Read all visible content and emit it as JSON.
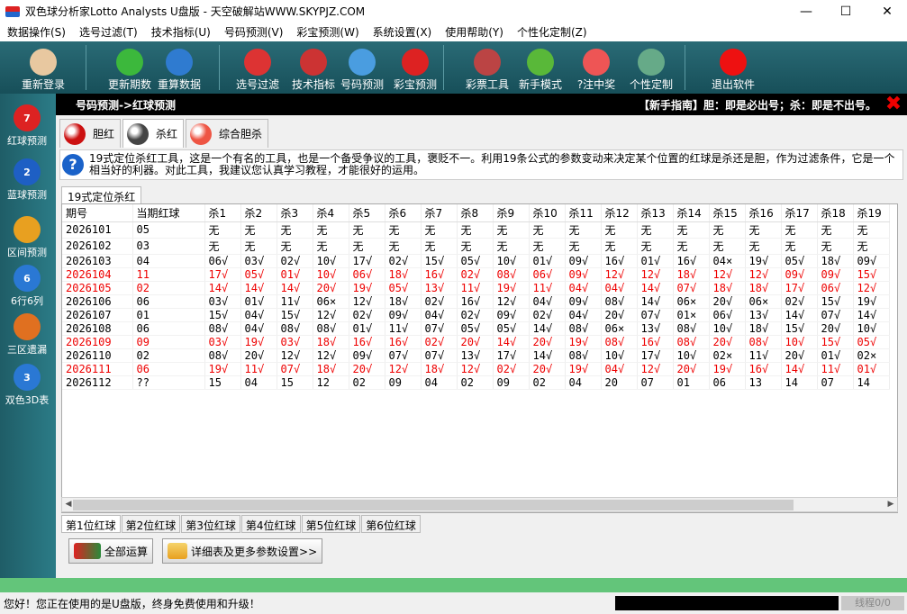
{
  "window": {
    "title": "双色球分析家Lotto Analysts U盘版 - 天空破解站WWW.SKYPJZ.COM"
  },
  "menu": [
    "数据操作(S)",
    "选号过滤(T)",
    "技术指标(U)",
    "号码预测(V)",
    "彩宝预测(W)",
    "系统设置(X)",
    "使用帮助(Y)",
    "个性化定制(Z)"
  ],
  "toolbar": [
    {
      "label": "重新登录",
      "icon": "user-icon",
      "color": "#e8c8a0"
    },
    {
      "label": "更新期数",
      "icon": "plus-icon",
      "color": "#3cb83c"
    },
    {
      "label": "重算数据",
      "icon": "recycle-icon",
      "color": "#2f7bd0"
    },
    {
      "label": "选号过滤",
      "icon": "filter-icon",
      "color": "#d33"
    },
    {
      "label": "技术指标",
      "icon": "chart-icon",
      "color": "#c33"
    },
    {
      "label": "号码预测",
      "icon": "forecast-icon",
      "color": "#4a9de0"
    },
    {
      "label": "彩宝预测",
      "icon": "treasure-icon",
      "color": "#d22"
    },
    {
      "label": "彩票工具",
      "icon": "shop-icon",
      "color": "#b44"
    },
    {
      "label": "新手模式",
      "icon": "chat-icon",
      "color": "#59b839"
    },
    {
      "label": "?注中奖",
      "icon": "prize-icon",
      "color": "#e55"
    },
    {
      "label": "个性定制",
      "icon": "clipboard-icon",
      "color": "#6a8"
    },
    {
      "label": "退出软件",
      "icon": "exit-icon",
      "color": "#e11"
    }
  ],
  "leftnav": [
    {
      "label": "红球预测",
      "icon": "red-ball-icon",
      "glyph": "7",
      "color": "#d22"
    },
    {
      "label": "蓝球预测",
      "icon": "blue-ball-icon",
      "glyph": "2",
      "color": "#1e5fc4"
    },
    {
      "label": "区间预测",
      "icon": "pie-icon",
      "glyph": "",
      "color": "#e8a020"
    },
    {
      "label": "6行6列",
      "icon": "grid-ball-icon",
      "glyph": "6",
      "color": "#2a78d4"
    },
    {
      "label": "三区遗漏",
      "icon": "bar-chart-icon",
      "glyph": "",
      "color": "#e07020"
    },
    {
      "label": "双色3D表",
      "icon": "3d-ball-icon",
      "glyph": "3",
      "color": "#2a78d4"
    }
  ],
  "crumb": "号码预测->红球预测",
  "guide": "【新手指南】胆：即是必出号；杀：即是不出号。",
  "tabs": [
    {
      "label": "胆红",
      "color": "#c11"
    },
    {
      "label": "杀红",
      "color": "#444"
    },
    {
      "label": "综合胆杀",
      "color": "#e54"
    }
  ],
  "info": "19式定位杀红工具，这是一个有名的工具，也是一个备受争议的工具，褒贬不一。利用19条公式的参数变动来决定某个位置的红球是杀还是胆，作为过滤条件，它是一个相当好的利器。对此工具，我建议您认真学习教程，才能很好的运用。",
  "subtab": "19式定位杀红",
  "table": {
    "headers": [
      "期号",
      "当期红球",
      "杀1",
      "杀2",
      "杀3",
      "杀4",
      "杀5",
      "杀6",
      "杀7",
      "杀8",
      "杀9",
      "杀10",
      "杀11",
      "杀12",
      "杀13",
      "杀14",
      "杀15",
      "杀16",
      "杀17",
      "杀18",
      "杀19"
    ],
    "rows": [
      {
        "red": false,
        "cells": [
          "2026101",
          "05",
          "无",
          "无",
          "无",
          "无",
          "无",
          "无",
          "无",
          "无",
          "无",
          "无",
          "无",
          "无",
          "无",
          "无",
          "无",
          "无",
          "无",
          "无",
          "无"
        ]
      },
      {
        "red": false,
        "cells": [
          "2026102",
          "03",
          "无",
          "无",
          "无",
          "无",
          "无",
          "无",
          "无",
          "无",
          "无",
          "无",
          "无",
          "无",
          "无",
          "无",
          "无",
          "无",
          "无",
          "无",
          "无"
        ]
      },
      {
        "red": false,
        "cells": [
          "2026103",
          "04",
          "06√",
          "03√",
          "02√",
          "10√",
          "17√",
          "02√",
          "15√",
          "05√",
          "10√",
          "01√",
          "09√",
          "16√",
          "01√",
          "16√",
          "04×",
          "19√",
          "05√",
          "18√",
          "09√"
        ]
      },
      {
        "red": true,
        "cells": [
          "2026104",
          "11",
          "17√",
          "05√",
          "01√",
          "10√",
          "06√",
          "18√",
          "16√",
          "02√",
          "08√",
          "06√",
          "09√",
          "12√",
          "12√",
          "18√",
          "12√",
          "12√",
          "09√",
          "09√",
          "15√"
        ]
      },
      {
        "red": true,
        "cells": [
          "2026105",
          "02",
          "14√",
          "14√",
          "14√",
          "20√",
          "19√",
          "05√",
          "13√",
          "11√",
          "19√",
          "11√",
          "04√",
          "04√",
          "14√",
          "07√",
          "18√",
          "18√",
          "17√",
          "06√",
          "12√"
        ]
      },
      {
        "red": false,
        "cells": [
          "2026106",
          "06",
          "03√",
          "01√",
          "11√",
          "06×",
          "12√",
          "18√",
          "02√",
          "16√",
          "12√",
          "04√",
          "09√",
          "08√",
          "14√",
          "06×",
          "20√",
          "06×",
          "02√",
          "15√",
          "19√"
        ]
      },
      {
        "red": false,
        "cells": [
          "2026107",
          "01",
          "15√",
          "04√",
          "15√",
          "12√",
          "02√",
          "09√",
          "04√",
          "02√",
          "09√",
          "02√",
          "04√",
          "20√",
          "07√",
          "01×",
          "06√",
          "13√",
          "14√",
          "07√",
          "14√"
        ]
      },
      {
        "red": false,
        "cells": [
          "2026108",
          "06",
          "08√",
          "04√",
          "08√",
          "08√",
          "01√",
          "11√",
          "07√",
          "05√",
          "05√",
          "14√",
          "08√",
          "06×",
          "13√",
          "08√",
          "10√",
          "18√",
          "15√",
          "20√",
          "10√"
        ]
      },
      {
        "red": true,
        "cells": [
          "2026109",
          "09",
          "03√",
          "19√",
          "03√",
          "18√",
          "16√",
          "16√",
          "02√",
          "20√",
          "14√",
          "20√",
          "19√",
          "08√",
          "16√",
          "08√",
          "20√",
          "08√",
          "10√",
          "15√",
          "05√"
        ]
      },
      {
        "red": false,
        "cells": [
          "2026110",
          "02",
          "08√",
          "20√",
          "12√",
          "12√",
          "09√",
          "07√",
          "07√",
          "13√",
          "17√",
          "14√",
          "08√",
          "10√",
          "17√",
          "10√",
          "02×",
          "11√",
          "20√",
          "01√",
          "02×"
        ]
      },
      {
        "red": true,
        "cells": [
          "2026111",
          "06",
          "19√",
          "11√",
          "07√",
          "18√",
          "20√",
          "12√",
          "18√",
          "12√",
          "02√",
          "20√",
          "19√",
          "04√",
          "12√",
          "20√",
          "19√",
          "16√",
          "14√",
          "11√",
          "01√"
        ]
      },
      {
        "red": false,
        "cells": [
          "2026112",
          "??",
          "15",
          "04",
          "15",
          "12",
          "02",
          "09",
          "04",
          "02",
          "09",
          "02",
          "04",
          "20",
          "07",
          "01",
          "06",
          "13",
          "14",
          "07",
          "14"
        ]
      }
    ]
  },
  "position_tabs": [
    "第1位红球",
    "第2位红球",
    "第3位红球",
    "第4位红球",
    "第5位红球",
    "第6位红球"
  ],
  "actions": {
    "calc_all": "全部运算",
    "detail": "详细表及更多参数设置>>"
  },
  "status": {
    "message": "您好！您正在使用的是U盘版，终身免费使用和升级！",
    "thread": "线程0/0"
  }
}
